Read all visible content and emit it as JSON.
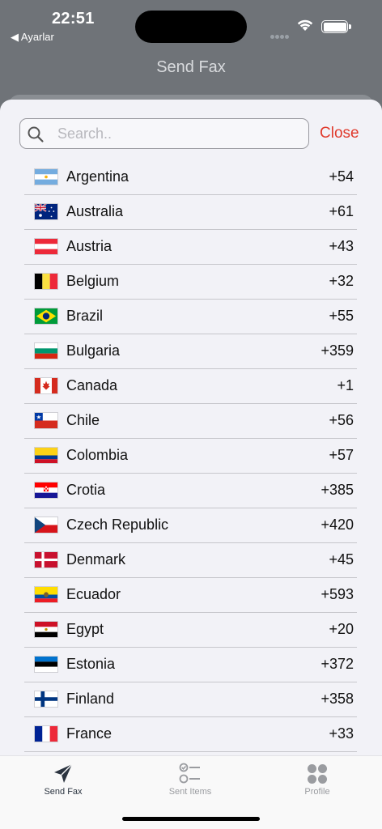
{
  "status_bar": {
    "time": "22:51",
    "back_app": "◀ Ayarlar"
  },
  "header": {
    "title": "Send Fax"
  },
  "search": {
    "placeholder": "Search..",
    "value": "",
    "close_label": "Close"
  },
  "countries": [
    {
      "name": "Argentina",
      "code": "+54",
      "flag": "argentina-flag-icon"
    },
    {
      "name": "Australia",
      "code": "+61",
      "flag": "australia-flag-icon"
    },
    {
      "name": "Austria",
      "code": "+43",
      "flag": "austria-flag-icon"
    },
    {
      "name": "Belgium",
      "code": "+32",
      "flag": "belgium-flag-icon"
    },
    {
      "name": "Brazil",
      "code": "+55",
      "flag": "brazil-flag-icon"
    },
    {
      "name": "Bulgaria",
      "code": "+359",
      "flag": "bulgaria-flag-icon"
    },
    {
      "name": "Canada",
      "code": "+1",
      "flag": "canada-flag-icon"
    },
    {
      "name": "Chile",
      "code": "+56",
      "flag": "chile-flag-icon"
    },
    {
      "name": "Colombia",
      "code": "+57",
      "flag": "colombia-flag-icon"
    },
    {
      "name": "Crotia",
      "code": "+385",
      "flag": "croatia-flag-icon"
    },
    {
      "name": "Czech Republic",
      "code": "+420",
      "flag": "czech-flag-icon"
    },
    {
      "name": "Denmark",
      "code": "+45",
      "flag": "denmark-flag-icon"
    },
    {
      "name": "Ecuador",
      "code": "+593",
      "flag": "ecuador-flag-icon"
    },
    {
      "name": "Egypt",
      "code": "+20",
      "flag": "egypt-flag-icon"
    },
    {
      "name": "Estonia",
      "code": "+372",
      "flag": "estonia-flag-icon"
    },
    {
      "name": "Finland",
      "code": "+358",
      "flag": "finland-flag-icon"
    },
    {
      "name": "France",
      "code": "+33",
      "flag": "france-flag-icon"
    }
  ],
  "tabs": [
    {
      "label": "Send Fax",
      "icon": "paper-plane-icon",
      "active": true
    },
    {
      "label": "Sent Items",
      "icon": "checklist-icon",
      "active": false
    },
    {
      "label": "Profile",
      "icon": "grid-dots-icon",
      "active": false
    }
  ],
  "colors": {
    "accent": "#e03a2c",
    "active_tab": "#2b3440",
    "inactive_tab": "#9a9ca0"
  }
}
